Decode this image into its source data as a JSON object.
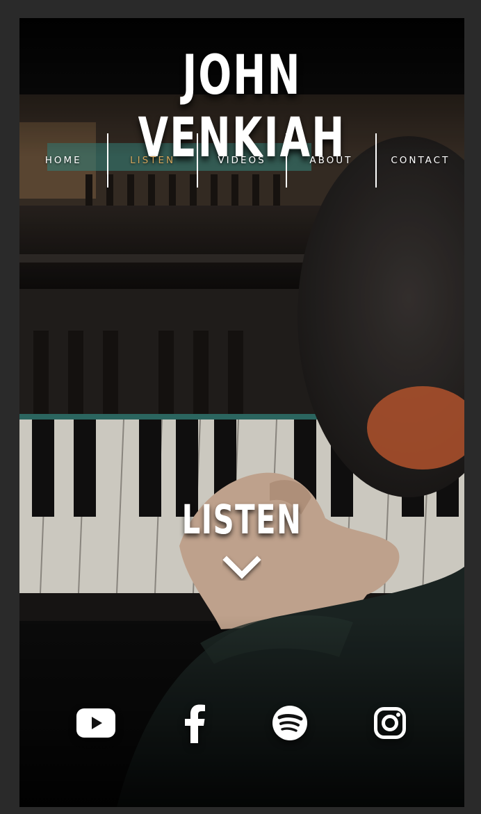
{
  "site": {
    "title": "JOHN VENKIAH"
  },
  "nav": {
    "items": [
      {
        "label": "HOME",
        "active": false
      },
      {
        "label": "LISTEN",
        "active": true
      },
      {
        "label": "VIDEOS",
        "active": false
      },
      {
        "label": "ABOUT",
        "active": false
      },
      {
        "label": "CONTACT",
        "active": false
      }
    ]
  },
  "hero": {
    "section_title": "LISTEN",
    "scroll_icon": "chevron-down-icon"
  },
  "social": {
    "icons": [
      "youtube-icon",
      "facebook-icon",
      "spotify-icon",
      "instagram-icon"
    ]
  },
  "colors": {
    "active_nav": "#d4a55c",
    "text": "#ffffff",
    "page_background": "#2a2a2a"
  }
}
